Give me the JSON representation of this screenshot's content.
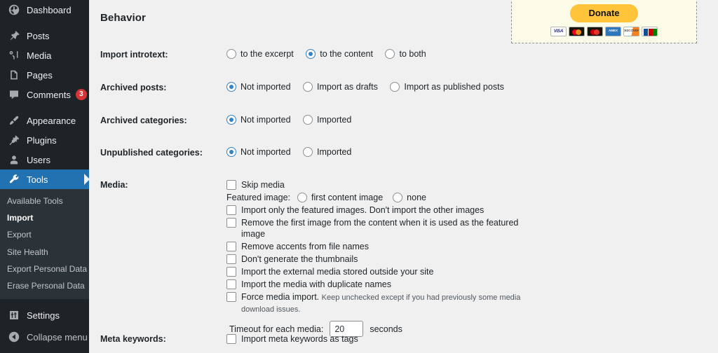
{
  "sidebar": {
    "items": [
      {
        "label": "Dashboard",
        "icon": "dashboard-icon",
        "name": "dashboard"
      },
      {
        "label": "Posts",
        "icon": "pin-icon",
        "name": "posts"
      },
      {
        "label": "Media",
        "icon": "media-icon",
        "name": "media"
      },
      {
        "label": "Pages",
        "icon": "pages-icon",
        "name": "pages"
      },
      {
        "label": "Comments",
        "icon": "comment-icon",
        "name": "comments",
        "badge": "3"
      },
      {
        "label": "Appearance",
        "icon": "brush-icon",
        "name": "appearance"
      },
      {
        "label": "Plugins",
        "icon": "plug-icon",
        "name": "plugins"
      },
      {
        "label": "Users",
        "icon": "user-icon",
        "name": "users"
      },
      {
        "label": "Tools",
        "icon": "wrench-icon",
        "name": "tools",
        "current": true
      },
      {
        "label": "Settings",
        "icon": "settings-icon",
        "name": "settings"
      }
    ],
    "submenu": [
      {
        "label": "Available Tools",
        "name": "available-tools"
      },
      {
        "label": "Import",
        "name": "import",
        "current": true
      },
      {
        "label": "Export",
        "name": "export"
      },
      {
        "label": "Site Health",
        "name": "site-health"
      },
      {
        "label": "Export Personal Data",
        "name": "export-personal-data"
      },
      {
        "label": "Erase Personal Data",
        "name": "erase-personal-data"
      }
    ],
    "collapse_label": "Collapse menu",
    "accent_color": "#2271b1",
    "background_color": "#1d2327",
    "submenu_background_color": "#2c3338",
    "badge_color": "#d63638"
  },
  "page": {
    "title": "Behavior"
  },
  "donate": {
    "button_label": "Donate",
    "cards": [
      "VISA",
      "mastercard",
      "mastercard-alt",
      "AMEX",
      "DISCOVER",
      "JCB"
    ],
    "background_color": "#fcfbe8",
    "button_color": "#ffc439"
  },
  "form": {
    "import_introtext": {
      "label": "Import introtext:",
      "options": [
        {
          "text": "to the excerpt",
          "checked": false
        },
        {
          "text": "to the content",
          "checked": true
        },
        {
          "text": "to both",
          "checked": false
        }
      ]
    },
    "archived_posts": {
      "label": "Archived posts:",
      "options": [
        {
          "text": "Not imported",
          "checked": true
        },
        {
          "text": "Import as drafts",
          "checked": false
        },
        {
          "text": "Import as published posts",
          "checked": false
        }
      ]
    },
    "archived_categories": {
      "label": "Archived categories:",
      "options": [
        {
          "text": "Not imported",
          "checked": true
        },
        {
          "text": "Imported",
          "checked": false
        }
      ]
    },
    "unpublished_categories": {
      "label": "Unpublished categories:",
      "options": [
        {
          "text": "Not imported",
          "checked": true
        },
        {
          "text": "Imported",
          "checked": false
        }
      ]
    },
    "media": {
      "label": "Media:",
      "skip_media": {
        "text": "Skip media",
        "checked": false
      },
      "featured_image_label": "Featured image:",
      "featured_image_options": [
        {
          "text": "first content image",
          "checked": false
        },
        {
          "text": "none",
          "checked": false
        }
      ],
      "checkboxes": [
        {
          "text": "Import only the featured images. Don't import the other images",
          "checked": false
        },
        {
          "text": "Remove the first image from the content when it is used as the featured image",
          "checked": false
        },
        {
          "text": "Remove accents from file names",
          "checked": false
        },
        {
          "text": "Don't generate the thumbnails",
          "checked": false
        },
        {
          "text": "Import the external media stored outside your site",
          "checked": false
        },
        {
          "text": "Import the media with duplicate names",
          "checked": false
        }
      ],
      "force_media_import": {
        "text": "Force media import.",
        "note": "Keep unchecked except if you had previously some media download issues.",
        "checked": false
      },
      "timeout_label": "Timeout for each media:",
      "timeout_value": "20",
      "timeout_unit": "seconds"
    },
    "meta_keywords": {
      "label": "Meta keywords:",
      "checkbox": {
        "text": "Import meta keywords as tags",
        "checked": false
      }
    }
  }
}
